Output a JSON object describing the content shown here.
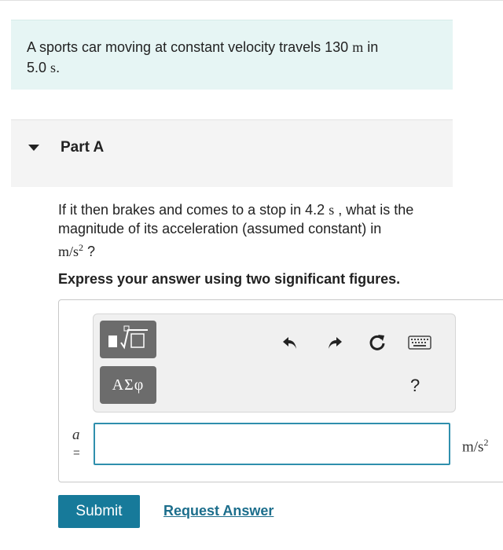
{
  "problem": {
    "text_1": "A sports car moving at constant velocity travels 130",
    "unit_1": "m",
    "text_2": "in",
    "text_3": "5.0",
    "unit_2": "s",
    "text_4": "."
  },
  "part": {
    "title": "Part A",
    "question_1": "If it then brakes and comes to a stop in 4.2",
    "question_unit": "s",
    "question_2": ", what is the magnitude of its acceleration (assumed constant) in",
    "question_unit_num": "m/s",
    "question_unit_exp": "2",
    "question_end": "?",
    "instruction": "Express your answer using two significant figures."
  },
  "toolbar": {
    "templates_icon": "templates-sqrt-icon",
    "symbols_label": "ΑΣφ",
    "undo_icon": "undo-icon",
    "redo_icon": "redo-icon",
    "reset_icon": "reset-icon",
    "keyboard_icon": "keyboard-icon",
    "help_label": "?"
  },
  "answer": {
    "variable": "a",
    "equals": "=",
    "value": "",
    "unit_base": "m/s",
    "unit_exp": "2"
  },
  "actions": {
    "submit_label": "Submit",
    "request_label": "Request Answer"
  },
  "colors": {
    "problem_bg": "#e6f5f4",
    "accent": "#177a9a",
    "input_border": "#2f8fad",
    "toolbar_button": "#6c6c6c"
  }
}
